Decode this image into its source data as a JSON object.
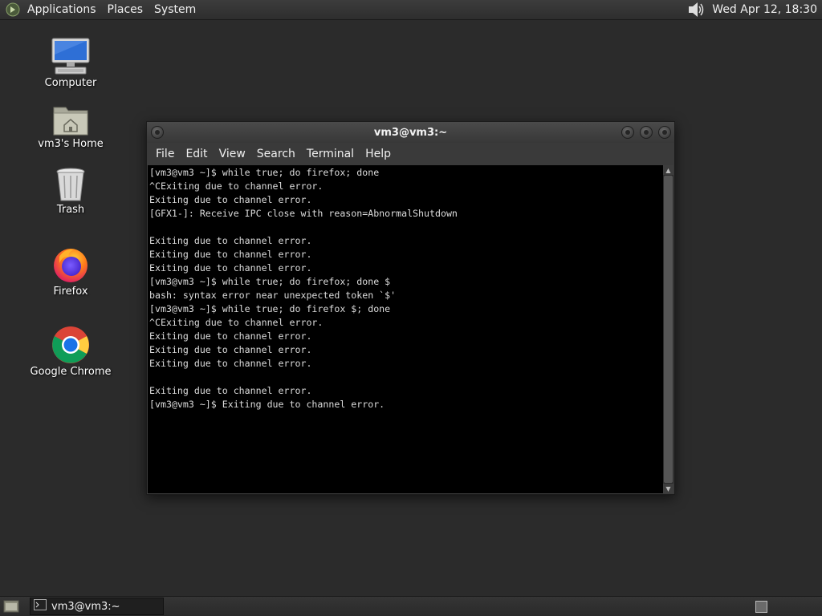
{
  "top_panel": {
    "menus": [
      "Applications",
      "Places",
      "System"
    ],
    "clock": "Wed Apr 12, 18:30",
    "icons": {
      "logo": "gnome-foot-icon",
      "volume": "speaker-volume-icon"
    }
  },
  "desktop": {
    "icons": [
      {
        "label": "Computer",
        "icon": "computer-icon"
      },
      {
        "label": "vm3's Home",
        "icon": "home-folder-icon"
      },
      {
        "label": "Trash",
        "icon": "trash-icon"
      },
      {
        "label": "Firefox",
        "icon": "firefox-icon"
      },
      {
        "label": "Google Chrome",
        "icon": "chrome-icon"
      }
    ]
  },
  "terminal": {
    "title": "vm3@vm3:~",
    "menus": [
      "File",
      "Edit",
      "View",
      "Search",
      "Terminal",
      "Help"
    ],
    "lines": [
      "[vm3@vm3 ~]$ while true; do firefox; done",
      "^CExiting due to channel error.",
      "Exiting due to channel error.",
      "[GFX1-]: Receive IPC close with reason=AbnormalShutdown",
      "",
      "Exiting due to channel error.",
      "Exiting due to channel error.",
      "Exiting due to channel error.",
      "[vm3@vm3 ~]$ while true; do firefox; done $",
      "bash: syntax error near unexpected token `$'",
      "[vm3@vm3 ~]$ while true; do firefox $; done",
      "^CExiting due to channel error.",
      "Exiting due to channel error.",
      "Exiting due to channel error.",
      "Exiting due to channel error.",
      "",
      "Exiting due to channel error.",
      "[vm3@vm3 ~]$ Exiting due to channel error."
    ]
  },
  "bottom_panel": {
    "task_label": "vm3@vm3:~",
    "icons": {
      "show_desktop": "show-desktop-icon",
      "task": "terminal-icon"
    }
  }
}
